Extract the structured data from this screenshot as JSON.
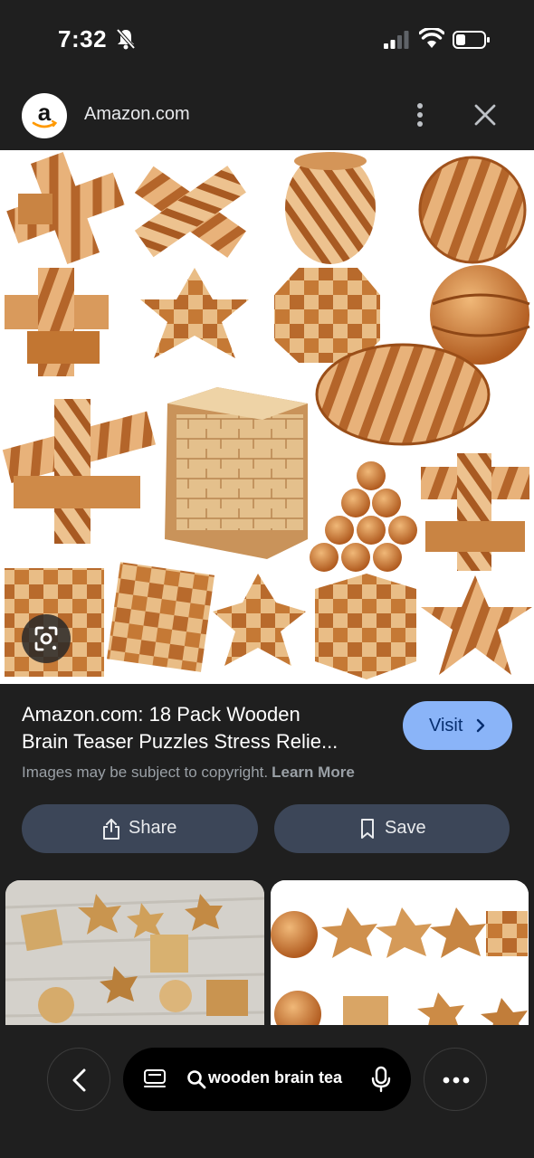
{
  "status_bar": {
    "time": "7:32",
    "icons": [
      "bell-off-icon",
      "signal-icon",
      "wifi-icon",
      "battery-icon"
    ]
  },
  "header": {
    "site_name": "Amazon.com",
    "logo_letter": "a",
    "icons": [
      "more-vert-icon",
      "close-icon"
    ]
  },
  "main_image": {
    "icon": "visual-search-icon"
  },
  "result": {
    "title_line1": "Amazon.com: 18 Pack Wooden",
    "title_line2": "Brain Teaser Puzzles Stress Relie...",
    "visit_label": "Visit",
    "copyright": "Images may be subject to copyright.",
    "learn_more": "Learn More"
  },
  "actions": {
    "share_label": "Share",
    "save_label": "Save"
  },
  "bottom_bar": {
    "query": "wooden brain tea",
    "icons": [
      "back-icon",
      "tabs-icon",
      "search-icon",
      "mic-icon",
      "more-horiz-icon"
    ]
  },
  "colors": {
    "background": "#1f1f1f",
    "visit_button": "#8ab4f8",
    "action_button": "#3c4658",
    "wood_light": "#e8b27a",
    "wood_dark": "#b4652a"
  }
}
